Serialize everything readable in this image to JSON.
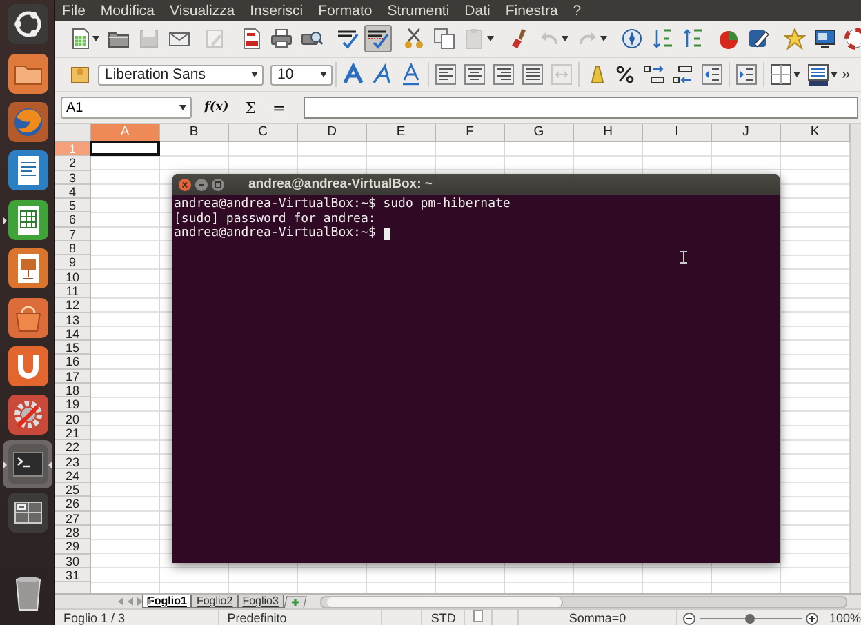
{
  "launcher": [
    {
      "running": false,
      "selected": false
    },
    {
      "running": false,
      "selected": false
    },
    {
      "running": false,
      "selected": false
    },
    {
      "running": false,
      "selected": false
    },
    {
      "running": true,
      "selected": false
    },
    {
      "running": false,
      "selected": false
    },
    {
      "running": false,
      "selected": false
    },
    {
      "running": false,
      "selected": false
    },
    {
      "running": false,
      "selected": false
    },
    {
      "running": true,
      "selected": true
    },
    {
      "running": false,
      "selected": false
    },
    {
      "running": false,
      "selected": false
    }
  ],
  "menu": [
    "File",
    "Modifica",
    "Visualizza",
    "Inserisci",
    "Formato",
    "Strumenti",
    "Dati",
    "Finestra",
    "?"
  ],
  "toolbar_standard": [
    {
      "disabled": false,
      "pressed": false,
      "menu": true
    },
    {
      "disabled": false,
      "pressed": false,
      "menu": false
    },
    {
      "disabled": true,
      "pressed": false,
      "menu": false
    },
    {
      "disabled": false,
      "pressed": false,
      "menu": false
    },
    {
      "disabled": true,
      "pressed": false,
      "menu": false
    },
    {
      "disabled": false,
      "pressed": false,
      "menu": false
    },
    {
      "disabled": false,
      "pressed": false,
      "menu": false
    },
    {
      "disabled": false,
      "pressed": false,
      "menu": false
    },
    {
      "disabled": false,
      "pressed": false,
      "menu": false
    },
    {
      "disabled": false,
      "pressed": true,
      "menu": false
    },
    {
      "disabled": false,
      "pressed": false,
      "menu": false
    },
    {
      "disabled": false,
      "pressed": false,
      "menu": false
    },
    {
      "disabled": true,
      "pressed": false,
      "menu": true
    },
    {
      "disabled": false,
      "pressed": false,
      "menu": false
    },
    {
      "disabled": true,
      "pressed": false,
      "menu": true
    },
    {
      "disabled": true,
      "pressed": false,
      "menu": true
    },
    {
      "disabled": false,
      "pressed": false,
      "menu": false
    },
    {
      "disabled": false,
      "pressed": false,
      "menu": false
    },
    {
      "disabled": false,
      "pressed": false,
      "menu": false
    },
    {
      "disabled": false,
      "pressed": false,
      "menu": false
    },
    {
      "disabled": false,
      "pressed": false,
      "menu": false
    },
    {
      "disabled": false,
      "pressed": false,
      "menu": false
    },
    {
      "disabled": false,
      "pressed": false,
      "menu": false
    },
    {
      "disabled": false,
      "pressed": false,
      "menu": false
    }
  ],
  "toolbar_format": {
    "font_name": "Liberation Sans",
    "font_size": "10",
    "overflow": "»",
    "buttons": [
      {
        "disabled": false,
        "menu": false
      },
      {
        "disabled": false,
        "menu": false
      },
      {
        "disabled": false,
        "menu": false
      },
      {
        "disabled": false,
        "menu": false
      },
      {
        "disabled": false,
        "menu": false
      },
      {
        "disabled": false,
        "menu": false
      },
      {
        "disabled": false,
        "menu": false
      },
      {
        "disabled": false,
        "menu": false
      },
      {
        "disabled": true,
        "menu": false
      },
      {
        "disabled": false,
        "menu": false
      },
      {
        "disabled": false,
        "menu": false
      },
      {
        "disabled": false,
        "menu": false
      },
      {
        "disabled": false,
        "menu": false
      },
      {
        "disabled": false,
        "menu": false
      },
      {
        "disabled": false,
        "menu": false
      },
      {
        "disabled": false,
        "menu": true
      },
      {
        "disabled": false,
        "menu": true
      }
    ]
  },
  "formula_bar": {
    "name_box": "A1",
    "buttons": [
      "f(x)",
      "Σ",
      "="
    ]
  },
  "sheet": {
    "columns": [
      {
        "label": "A",
        "selected": true
      },
      {
        "label": "B",
        "selected": false
      },
      {
        "label": "C",
        "selected": false
      },
      {
        "label": "D",
        "selected": false
      },
      {
        "label": "E",
        "selected": false
      },
      {
        "label": "F",
        "selected": false
      },
      {
        "label": "G",
        "selected": false
      },
      {
        "label": "H",
        "selected": false
      },
      {
        "label": "I",
        "selected": false
      },
      {
        "label": "J",
        "selected": false
      },
      {
        "label": "K",
        "selected": false
      }
    ],
    "rows": [
      {
        "label": "1",
        "selected": true
      },
      {
        "label": "2",
        "selected": false
      },
      {
        "label": "3",
        "selected": false
      },
      {
        "label": "4",
        "selected": false
      },
      {
        "label": "5",
        "selected": false
      },
      {
        "label": "6",
        "selected": false
      },
      {
        "label": "7",
        "selected": false
      },
      {
        "label": "8",
        "selected": false
      },
      {
        "label": "9",
        "selected": false
      },
      {
        "label": "10",
        "selected": false
      },
      {
        "label": "11",
        "selected": false
      },
      {
        "label": "12",
        "selected": false
      },
      {
        "label": "13",
        "selected": false
      },
      {
        "label": "14",
        "selected": false
      },
      {
        "label": "15",
        "selected": false
      },
      {
        "label": "16",
        "selected": false
      },
      {
        "label": "17",
        "selected": false
      },
      {
        "label": "18",
        "selected": false
      },
      {
        "label": "19",
        "selected": false
      },
      {
        "label": "20",
        "selected": false
      },
      {
        "label": "21",
        "selected": false
      },
      {
        "label": "22",
        "selected": false
      },
      {
        "label": "23",
        "selected": false
      },
      {
        "label": "24",
        "selected": false
      },
      {
        "label": "25",
        "selected": false
      },
      {
        "label": "26",
        "selected": false
      },
      {
        "label": "27",
        "selected": false
      },
      {
        "label": "28",
        "selected": false
      },
      {
        "label": "29",
        "selected": false
      },
      {
        "label": "30",
        "selected": false
      },
      {
        "label": "31",
        "selected": false
      }
    ]
  },
  "sheet_tabs": [
    {
      "label": "Foglio1",
      "selected": true
    },
    {
      "label": "Foglio2",
      "selected": false
    },
    {
      "label": "Foglio3",
      "selected": false
    }
  ],
  "status_bar": {
    "sheet": "Foglio 1 / 3",
    "style": "Predefinito",
    "mode": "STD",
    "sum": "Somma=0",
    "zoom": {
      "level": 0.5
    },
    "zoom_reading": "100%"
  },
  "terminal": {
    "title": "andrea@andrea-VirtualBox: ~",
    "lines": [
      "andrea@andrea-VirtualBox:~$ sudo pm-hibernate",
      "[sudo] password for andrea:",
      "andrea@andrea-VirtualBox:~$"
    ],
    "cursor_visible": true
  }
}
